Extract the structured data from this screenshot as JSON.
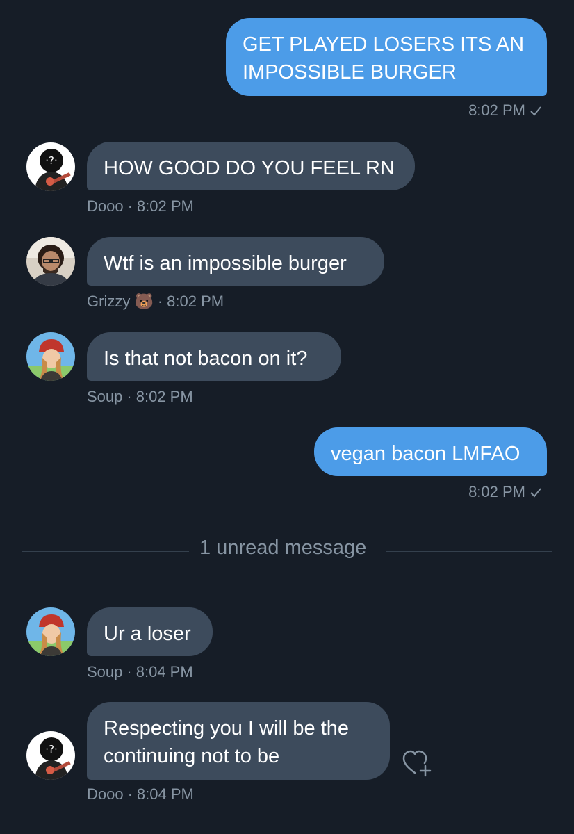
{
  "messages": [
    {
      "side": "out",
      "text": "GET PLAYED LOSERS ITS AN\nIMPOSSIBLE BURGER",
      "time": "8:02 PM"
    },
    {
      "side": "in",
      "sender": "Dooo",
      "text": "HOW GOOD DO YOU FEEL RN",
      "time": "8:02 PM"
    },
    {
      "side": "in",
      "sender": "Grizzy 🐻",
      "text": "Wtf is an impossible burger",
      "time": "8:02 PM"
    },
    {
      "side": "in",
      "sender": "Soup",
      "text": "Is that not bacon on it?",
      "time": "8:02 PM"
    },
    {
      "side": "out",
      "text": "vegan bacon LMFAO",
      "time": "8:02 PM"
    },
    {
      "side": "in",
      "sender": "Soup",
      "text": "Ur a loser",
      "time": "8:04 PM"
    },
    {
      "side": "in",
      "sender": "Dooo",
      "text": "Respecting you I will be the\ncontinuing not to be",
      "time": "8:04 PM"
    }
  ],
  "divider": {
    "text": "1 unread message"
  },
  "icons": {
    "read_check": "checkmark-icon",
    "react": "heart-plus-icon"
  },
  "colors": {
    "background": "#161d27",
    "outgoing": "#4c9ce8",
    "incoming": "#3d4b5c",
    "meta": "#8795a3"
  }
}
